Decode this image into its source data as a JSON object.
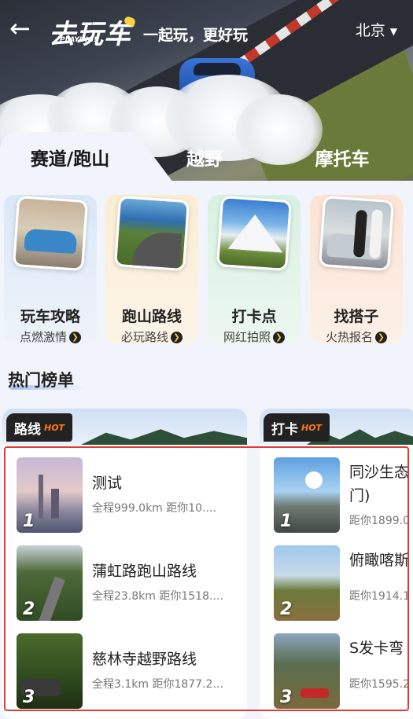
{
  "header": {
    "back_icon": "arrow-left-icon",
    "logo_text": "去玩车",
    "logo_sub": "PLAYING!",
    "slogan": "一起玩，更好玩",
    "city": "北京",
    "city_caret": "▼"
  },
  "tabs": [
    {
      "label": "赛道/跑山",
      "active": true
    },
    {
      "label": "越野",
      "active": false
    },
    {
      "label": "摩托车",
      "active": false
    }
  ],
  "categories": [
    {
      "title": "玩车攻略",
      "subtitle": "点燃激情",
      "icon": "sports-car-photo"
    },
    {
      "title": "跑山路线",
      "subtitle": "必玩路线",
      "icon": "mountain-road-photo"
    },
    {
      "title": "打卡点",
      "subtitle": "网红拍照",
      "icon": "snow-mountain-photo"
    },
    {
      "title": "找搭子",
      "subtitle": "火热报名",
      "icon": "friends-car-photo"
    }
  ],
  "hot_list": {
    "title": "热门榜单",
    "hot_tag": "HOT",
    "route_card": {
      "badge": "路线",
      "items": [
        {
          "rank": "1",
          "name": "测试",
          "meta": "全程999.0km  距你10...."
        },
        {
          "rank": "2",
          "name": "蒲虹路跑山路线",
          "meta": "全程23.8km  距你1518...."
        },
        {
          "rank": "3",
          "name": "慈林寺越野路线",
          "meta": "全程3.1km  距你1877.2..."
        }
      ]
    },
    "checkin_card": {
      "badge": "打卡",
      "items": [
        {
          "rank": "1",
          "name": "同沙生态门)",
          "meta": "距你1899.0"
        },
        {
          "rank": "2",
          "name": "俯瞰喀斯",
          "meta": "距你1914.1"
        },
        {
          "rank": "3",
          "name": "S发卡弯",
          "meta": "距你1595.2"
        }
      ]
    }
  },
  "colors": {
    "accent": "#e53935",
    "hot": "#ff7a1a",
    "badge_dot": "#ffcf2f"
  }
}
